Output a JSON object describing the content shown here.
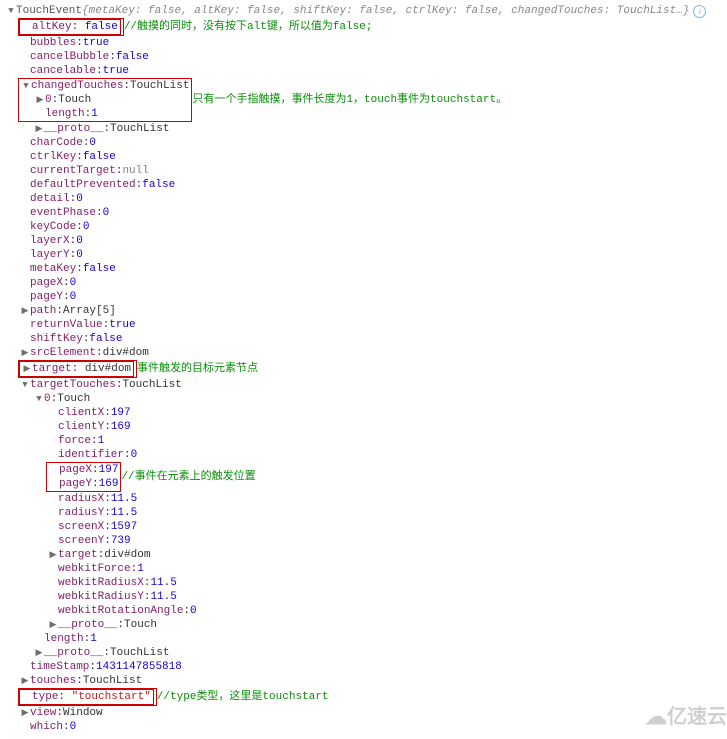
{
  "header": {
    "type": "TouchEvent",
    "preview": "{metaKey: false, altKey: false, shiftKey: false, ctrlKey: false, changedTouches: TouchList…}"
  },
  "rows": [
    {
      "indent": 1,
      "tog": "none",
      "box": true,
      "key": "altKey",
      "val": "false",
      "vtype": "bool",
      "cmt": "//触摸的同时，没有按下alt键，所以值为false;"
    },
    {
      "indent": 1,
      "tog": "none",
      "box": false,
      "key": "bubbles",
      "val": "true",
      "vtype": "bool"
    },
    {
      "indent": 1,
      "tog": "none",
      "box": false,
      "key": "cancelBubble",
      "val": "false",
      "vtype": "bool"
    },
    {
      "indent": 1,
      "tog": "none",
      "box": false,
      "key": "cancelable",
      "val": "true",
      "vtype": "bool"
    },
    {
      "indent": 1,
      "tog": "down",
      "box": true,
      "key": "changedTouches",
      "val": "TouchList",
      "vtype": "ref",
      "cmt": "只有一个手指触摸，事件长度为1，touch事件为touchstart。",
      "boxwrap": 2
    },
    {
      "indent": 2,
      "tog": "right",
      "box": false,
      "key": "0",
      "val": "Touch",
      "vtype": "ref",
      "inbox": true
    },
    {
      "indent": 2,
      "tog": "none",
      "box": false,
      "key": "length",
      "val": "1",
      "vtype": "num",
      "inbox": true
    },
    {
      "indent": 2,
      "tog": "right",
      "box": false,
      "key": "__proto__",
      "val": "TouchList",
      "vtype": "ref"
    },
    {
      "indent": 1,
      "tog": "none",
      "box": false,
      "key": "charCode",
      "val": "0",
      "vtype": "num"
    },
    {
      "indent": 1,
      "tog": "none",
      "box": false,
      "key": "ctrlKey",
      "val": "false",
      "vtype": "bool"
    },
    {
      "indent": 1,
      "tog": "none",
      "box": false,
      "key": "currentTarget",
      "val": "null",
      "vtype": "null"
    },
    {
      "indent": 1,
      "tog": "none",
      "box": false,
      "key": "defaultPrevented",
      "val": "false",
      "vtype": "bool"
    },
    {
      "indent": 1,
      "tog": "none",
      "box": false,
      "key": "detail",
      "val": "0",
      "vtype": "num"
    },
    {
      "indent": 1,
      "tog": "none",
      "box": false,
      "key": "eventPhase",
      "val": "0",
      "vtype": "num"
    },
    {
      "indent": 1,
      "tog": "none",
      "box": false,
      "key": "keyCode",
      "val": "0",
      "vtype": "num"
    },
    {
      "indent": 1,
      "tog": "none",
      "box": false,
      "key": "layerX",
      "val": "0",
      "vtype": "num"
    },
    {
      "indent": 1,
      "tog": "none",
      "box": false,
      "key": "layerY",
      "val": "0",
      "vtype": "num"
    },
    {
      "indent": 1,
      "tog": "none",
      "box": false,
      "key": "metaKey",
      "val": "false",
      "vtype": "bool"
    },
    {
      "indent": 1,
      "tog": "none",
      "box": false,
      "key": "pageX",
      "val": "0",
      "vtype": "num"
    },
    {
      "indent": 1,
      "tog": "none",
      "box": false,
      "key": "pageY",
      "val": "0",
      "vtype": "num"
    },
    {
      "indent": 1,
      "tog": "right",
      "box": false,
      "key": "path",
      "val": "Array[5]",
      "vtype": "ref"
    },
    {
      "indent": 1,
      "tog": "none",
      "box": false,
      "key": "returnValue",
      "val": "true",
      "vtype": "bool"
    },
    {
      "indent": 1,
      "tog": "none",
      "box": false,
      "key": "shiftKey",
      "val": "false",
      "vtype": "bool"
    },
    {
      "indent": 1,
      "tog": "right",
      "box": false,
      "key": "srcElement",
      "val": "div#dom",
      "vtype": "ref"
    },
    {
      "indent": 1,
      "tog": "right",
      "box": true,
      "key": "target",
      "val": "div#dom",
      "vtype": "ref",
      "cmt": "事件触发的目标元素节点"
    },
    {
      "indent": 1,
      "tog": "down",
      "box": false,
      "key": "targetTouches",
      "val": "TouchList",
      "vtype": "ref"
    },
    {
      "indent": 2,
      "tog": "down",
      "box": false,
      "key": "0",
      "val": "Touch",
      "vtype": "ref"
    },
    {
      "indent": 3,
      "tog": "none",
      "box": false,
      "key": "clientX",
      "val": "197",
      "vtype": "num"
    },
    {
      "indent": 3,
      "tog": "none",
      "box": false,
      "key": "clientY",
      "val": "169",
      "vtype": "num"
    },
    {
      "indent": 3,
      "tog": "none",
      "box": false,
      "key": "force",
      "val": "1",
      "vtype": "num"
    },
    {
      "indent": 3,
      "tog": "none",
      "box": false,
      "key": "identifier",
      "val": "0",
      "vtype": "num"
    },
    {
      "indent": 3,
      "tog": "none",
      "box": true,
      "key": "pageX",
      "val": "197",
      "vtype": "num",
      "cmt": "//事件在元素上的触发位置",
      "boxwrap": 1
    },
    {
      "indent": 3,
      "tog": "none",
      "box": false,
      "key": "pageY",
      "val": "169",
      "vtype": "num",
      "inbox": true
    },
    {
      "indent": 3,
      "tog": "none",
      "box": false,
      "key": "radiusX",
      "val": "11.5",
      "vtype": "num"
    },
    {
      "indent": 3,
      "tog": "none",
      "box": false,
      "key": "radiusY",
      "val": "11.5",
      "vtype": "num"
    },
    {
      "indent": 3,
      "tog": "none",
      "box": false,
      "key": "screenX",
      "val": "1597",
      "vtype": "num"
    },
    {
      "indent": 3,
      "tog": "none",
      "box": false,
      "key": "screenY",
      "val": "739",
      "vtype": "num"
    },
    {
      "indent": 3,
      "tog": "right",
      "box": false,
      "key": "target",
      "val": "div#dom",
      "vtype": "ref"
    },
    {
      "indent": 3,
      "tog": "none",
      "box": false,
      "key": "webkitForce",
      "val": "1",
      "vtype": "num"
    },
    {
      "indent": 3,
      "tog": "none",
      "box": false,
      "key": "webkitRadiusX",
      "val": "11.5",
      "vtype": "num"
    },
    {
      "indent": 3,
      "tog": "none",
      "box": false,
      "key": "webkitRadiusY",
      "val": "11.5",
      "vtype": "num"
    },
    {
      "indent": 3,
      "tog": "none",
      "box": false,
      "key": "webkitRotationAngle",
      "val": "0",
      "vtype": "num"
    },
    {
      "indent": 3,
      "tog": "right",
      "box": false,
      "key": "__proto__",
      "val": "Touch",
      "vtype": "ref"
    },
    {
      "indent": 2,
      "tog": "none",
      "box": false,
      "key": "length",
      "val": "1",
      "vtype": "num"
    },
    {
      "indent": 2,
      "tog": "right",
      "box": false,
      "key": "__proto__",
      "val": "TouchList",
      "vtype": "ref"
    },
    {
      "indent": 1,
      "tog": "none",
      "box": false,
      "key": "timeStamp",
      "val": "1431147855818",
      "vtype": "num"
    },
    {
      "indent": 1,
      "tog": "right",
      "box": false,
      "key": "touches",
      "val": "TouchList",
      "vtype": "ref"
    },
    {
      "indent": 1,
      "tog": "none",
      "box": true,
      "key": "type",
      "val": "\"touchstart\"",
      "vtype": "str",
      "cmt": "//type类型，这里是touchstart"
    },
    {
      "indent": 1,
      "tog": "right",
      "box": false,
      "key": "view",
      "val": "Window",
      "vtype": "ref"
    },
    {
      "indent": 1,
      "tog": "none",
      "box": false,
      "key": "which",
      "val": "0",
      "vtype": "num"
    }
  ],
  "logo": "亿速云"
}
